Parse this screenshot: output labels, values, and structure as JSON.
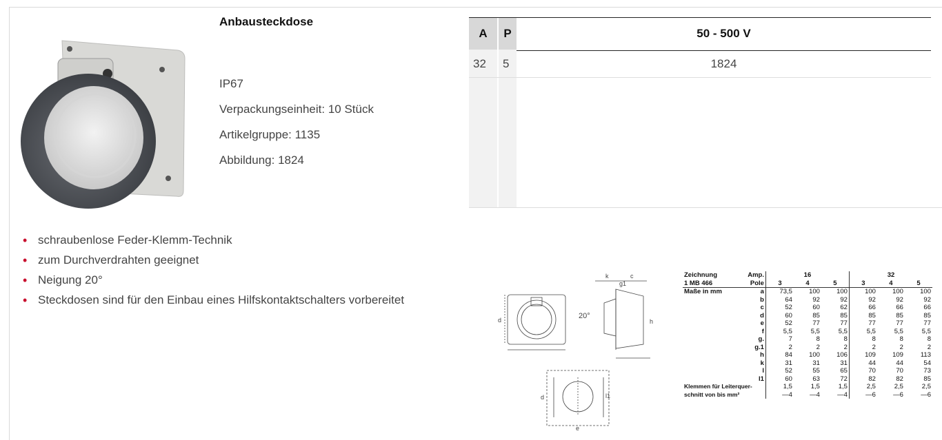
{
  "product": {
    "title": "Anbausteckdose",
    "info": [
      "IP67",
      "Verpackungseinheit: 10 Stück",
      "Artikelgruppe: 1135",
      "Abbildung: 1824"
    ]
  },
  "spec_table": {
    "headers": {
      "a": "A",
      "p": "P",
      "voltage": "50 - 500 V"
    },
    "row": {
      "a": "32",
      "p": "5",
      "value": "1824"
    }
  },
  "features": [
    "schraubenlose Feder-Klemm-Technik",
    "zum Durchverdrahten geeignet",
    "Neigung 20°",
    "Steckdosen sind für den Einbau eines Hilfskontaktschalters vorbereitet"
  ],
  "dimensions": {
    "header": {
      "zeichnung": "Zeichnung",
      "amp": "Amp.",
      "amp16": "16",
      "amp32": "32",
      "mb": "1 MB 466",
      "pole": "Pole",
      "poles": [
        "3",
        "4",
        "5",
        "3",
        "4",
        "5"
      ],
      "masse": "Maße in mm"
    },
    "rows": [
      {
        "k": "a",
        "v": [
          "73,5",
          "100",
          "100",
          "100",
          "100",
          "100"
        ]
      },
      {
        "k": "b",
        "v": [
          "64",
          "92",
          "92",
          "92",
          "92",
          "92"
        ]
      },
      {
        "k": "c",
        "v": [
          "52",
          "60",
          "62",
          "66",
          "66",
          "66"
        ]
      },
      {
        "k": "d",
        "v": [
          "60",
          "85",
          "85",
          "85",
          "85",
          "85"
        ]
      },
      {
        "k": "e",
        "v": [
          "52",
          "77",
          "77",
          "77",
          "77",
          "77"
        ]
      },
      {
        "k": "f",
        "v": [
          "5,5",
          "5,5",
          "5,5",
          "5,5",
          "5,5",
          "5,5"
        ]
      },
      {
        "k": "g.",
        "v": [
          "7",
          "8",
          "8",
          "8",
          "8",
          "8"
        ]
      },
      {
        "k": "g.1",
        "v": [
          "2",
          "2",
          "2",
          "2",
          "2",
          "2"
        ]
      },
      {
        "k": "h",
        "v": [
          "84",
          "100",
          "106",
          "109",
          "109",
          "113"
        ]
      },
      {
        "k": "k",
        "v": [
          "31",
          "31",
          "31",
          "44",
          "44",
          "54"
        ]
      },
      {
        "k": "l",
        "v": [
          "52",
          "55",
          "65",
          "70",
          "70",
          "73"
        ]
      },
      {
        "k": "l1",
        "v": [
          "60",
          "63",
          "72",
          "82",
          "82",
          "85"
        ]
      }
    ],
    "klemmen": {
      "label1": "Klemmen für Leiterquer-",
      "label2": "schnitt von bis mm²",
      "v1": [
        "1,5",
        "1,5",
        "1,5",
        "2,5",
        "2,5",
        "2,5"
      ],
      "v2": [
        "—4",
        "—4",
        "—4",
        "—6",
        "—6",
        "—6"
      ]
    }
  },
  "drawing_labels": {
    "angle": "20°",
    "g1": "g1",
    "c": "c",
    "k": "k",
    "d": "d",
    "h": "h",
    "e": "e",
    "l1": "l1",
    "l": "l"
  }
}
